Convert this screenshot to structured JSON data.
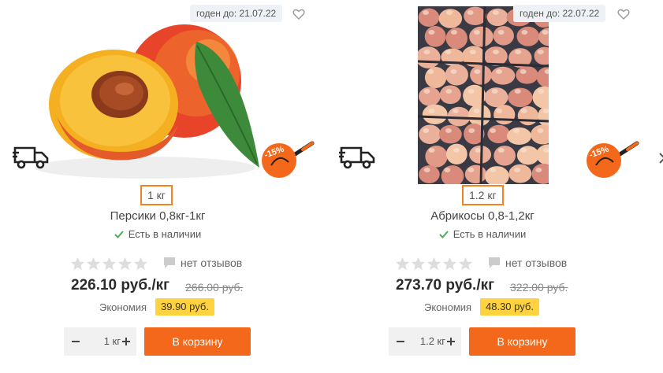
{
  "products": [
    {
      "expiry": "годен до: 21.07.22",
      "weight": "1 кг",
      "name": "Персики 0,8кг-1кг",
      "stock": "Есть в наличии",
      "reviews": "нет отзывов",
      "price": "226.10 руб./кг",
      "old_price": "266.00 руб.",
      "savings_label": "Экономия",
      "savings": "39.90 руб.",
      "qty": "1 кг",
      "cart_label": "В корзину",
      "discount": "-15%",
      "rating": 0
    },
    {
      "expiry": "годен до: 22.07.22",
      "weight": "1.2 кг",
      "name": "Абрикосы 0,8-1,2кг",
      "stock": "Есть в наличии",
      "reviews": "нет отзывов",
      "price": "273.70 руб./кг",
      "old_price": "322.00 руб.",
      "savings_label": "Экономия",
      "savings": "48.30 руб.",
      "qty": "1.2 кг",
      "cart_label": "В корзину",
      "discount": "-15%",
      "rating": 0
    }
  ],
  "icons": {
    "favorite": "heart-icon",
    "delivery": "delivery-truck-icon",
    "in_stock": "checkmark-icon",
    "review": "speech-bubble-icon",
    "star": "star-icon"
  },
  "colors": {
    "accent": "#f4681b",
    "weight_border": "#f58220",
    "savings_bg": "#ffd23f",
    "in_stock": "#4caf50",
    "expiry_bg": "#eef2f6",
    "star_empty": "#dddddd"
  }
}
